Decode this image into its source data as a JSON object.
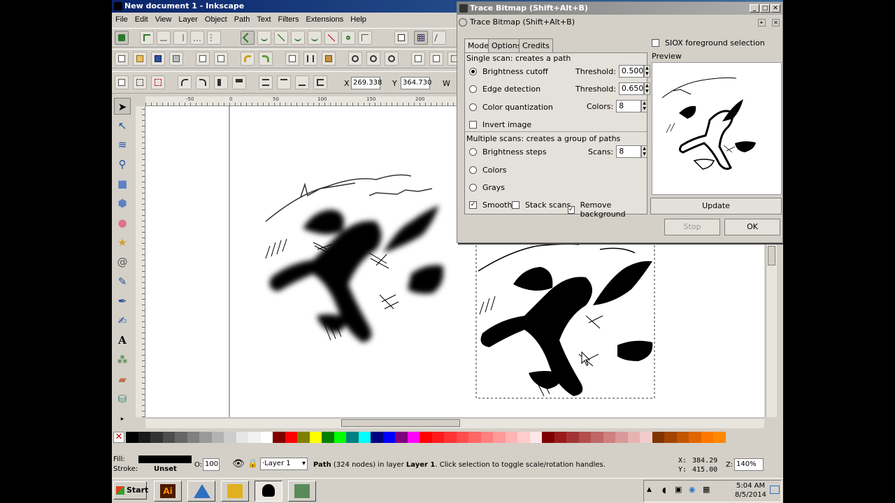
{
  "window": {
    "title": "New document 1 - Inkscape"
  },
  "menu": [
    "File",
    "Edit",
    "View",
    "Layer",
    "Object",
    "Path",
    "Text",
    "Filters",
    "Extensions",
    "Help"
  ],
  "coords": {
    "x_label": "X",
    "x_value": "269.338",
    "y_label": "Y",
    "y_value": "364.730",
    "w_label": "W"
  },
  "ruler": {
    "h_labels": [
      "-50",
      "0",
      "50",
      "100",
      "150",
      "200"
    ]
  },
  "dialog": {
    "title": "Trace Bitmap (Shift+Alt+B)",
    "subtitle": "Trace Bitmap (Shift+Alt+B)",
    "tabs": [
      "Mode",
      "Options",
      "Credits"
    ],
    "single_scan_label": "Single scan: creates a path",
    "brightness_cutoff": "Brightness cutoff",
    "edge_detection": "Edge detection",
    "color_quantization": "Color quantization",
    "invert_image": "Invert image",
    "threshold_label": "Threshold:",
    "threshold_1": "0.500",
    "threshold_2": "0.650",
    "colors_label": "Colors:",
    "colors_value": "8",
    "multiple_scans_label": "Multiple scans: creates a group of paths",
    "brightness_steps": "Brightness steps",
    "scans_label": "Scans:",
    "scans_value": "8",
    "colors_opt": "Colors",
    "grays_opt": "Grays",
    "smooth": "Smooth",
    "stack_scans": "Stack scans",
    "remove_background": "Remove background",
    "siox": "SIOX foreground selection",
    "preview_label": "Preview",
    "update_button": "Update",
    "stop_button": "Stop",
    "ok_button": "OK"
  },
  "status": {
    "fill_label": "Fill:",
    "stroke_label": "Stroke:",
    "stroke_value": "Unset",
    "opacity_label": "O:",
    "opacity_value": "100",
    "layer_value": "Layer 1",
    "message_path": "Path",
    "message_rest": " (324 nodes) in layer ",
    "message_layer": "Layer 1",
    "message_end": ". Click selection to toggle scale/rotation handles.",
    "cursor_x_label": "X:",
    "cursor_x": "384.29",
    "cursor_y_label": "Y:",
    "cursor_y": "415.00",
    "zoom_label": "Z:",
    "zoom_value": "140%"
  },
  "taskbar": {
    "start_label": "Start",
    "time": "5:04 AM",
    "date": "8/5/2014"
  },
  "colors": {
    "title_blue": "#0a246a",
    "chrome": "#d4d0c8"
  }
}
